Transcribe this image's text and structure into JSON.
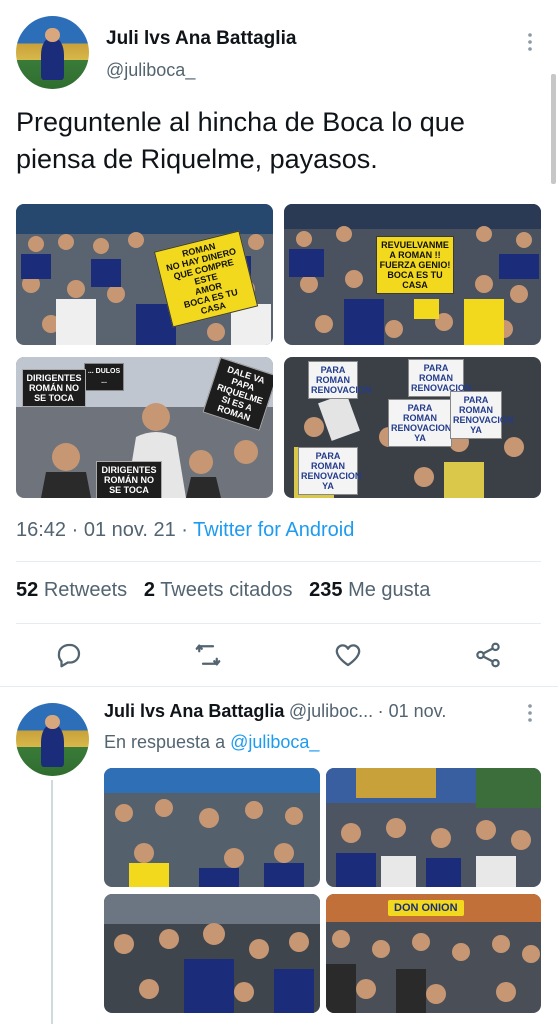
{
  "tweet": {
    "author": {
      "name": "Juli lvs Ana Battaglia",
      "handle": "@juliboca_"
    },
    "text_line1": "Preguntenle al hincha de Boca lo que",
    "text_line2": "piensa de Riquelme, payasos.",
    "signs": {
      "s1": "ROMAN\nNO HAY DINERO\nQUE COMPRE ESTE\nAMOR\nBOCA ES TU CASA",
      "s2": "REVUELVANME\nA ROMAN !!\nFUERZA GENIO!\nBOCA ES TU\nCASA",
      "s3": "DIRIGENTES\nROMÁN NO\nSE TOCA",
      "s4": "DIRIGENTES\nROMÁN NO\nSE TOCA",
      "s5": "... DULOS ...",
      "s6": "DALE VA\nPAPA\nRIQUELME\nSI ES A ROMAN",
      "s7": "PARA\nROMAN\nRENOVACION",
      "s8": "PARA\nROMAN\nRENOVACION",
      "s9": "PARA\nROMAN\nRENOVACION\nYA",
      "s10": "PARA\nROMAN\nRENOVACION\nYA",
      "s11": "PARA\nROMAN\nRENOVACION\nYA"
    },
    "time": "16:42 · 01 nov. 21 · ",
    "source": "Twitter for Android",
    "stats": {
      "retweets_count": "52",
      "retweets_label": "Retweets",
      "quotes_count": "2",
      "quotes_label": "Tweets citados",
      "likes_count": "235",
      "likes_label": "Me gusta"
    }
  },
  "reply": {
    "author": {
      "name": "Juli lvs Ana Battaglia",
      "handle": "@juliboc...",
      "date": "· 01 nov."
    },
    "reply_prefix": "En respuesta a ",
    "reply_to": "@juliboca_",
    "banner_text": "DON ONION"
  },
  "colors": {
    "accent": "#1d9bf0",
    "text": "#0f1419",
    "muted": "#536471",
    "boca_blue": "#1b2d7a",
    "boca_yellow": "#f3d91d"
  },
  "icons": [
    "more-vertical-icon",
    "reply-icon",
    "retweet-icon",
    "like-icon",
    "share-icon"
  ]
}
